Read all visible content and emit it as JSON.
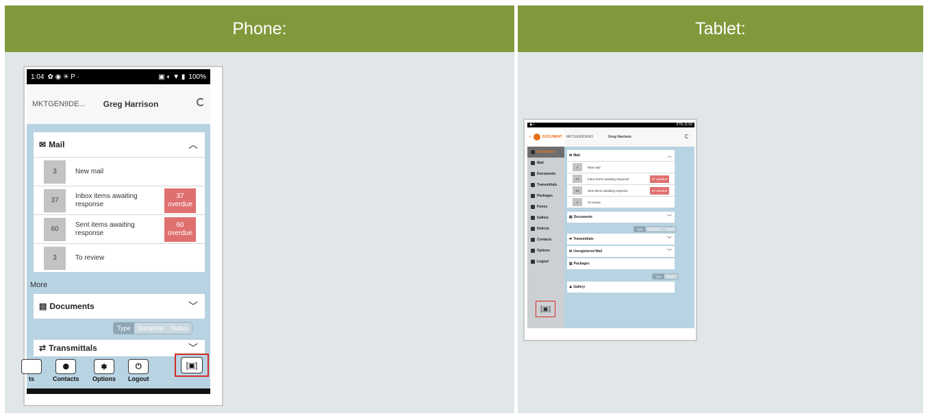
{
  "headers": {
    "phone": "Phone:",
    "tablet": "Tablet:"
  },
  "phone": {
    "status": {
      "time": "1:04",
      "right": "100%"
    },
    "account": "MKTGEN9DE...",
    "user": "Greg Harrison",
    "mail": {
      "title": "Mail",
      "rows": [
        {
          "count": "3",
          "label": "New mail",
          "overdue": ""
        },
        {
          "count": "37",
          "label": "Inbox items awaiting response",
          "overdue_num": "37",
          "overdue_text": "overdue"
        },
        {
          "count": "60",
          "label": "Sent items awaiting response",
          "overdue_num": "60",
          "overdue_text": "overdue"
        },
        {
          "count": "3",
          "label": "To review",
          "overdue": ""
        }
      ]
    },
    "more": "More",
    "documents": "Documents",
    "segments": [
      "Type",
      "Discipline",
      "Status"
    ],
    "transmittals": "Transmittals",
    "tabbar": [
      "ts",
      "Contacts",
      "Options",
      "Logout"
    ]
  },
  "tablet": {
    "status_right": "97% 11:00",
    "logo": "DOCUMENT",
    "account": "MKTGEN9DEMO",
    "user": "Greg Harrison",
    "sidebar": [
      "Dashboard",
      "Mail",
      "Documents",
      "Transmittals",
      "Packages",
      "Forms",
      "Gallery",
      "Defects",
      "Contacts",
      "Options",
      "Logout"
    ],
    "mail": {
      "title": "Mail",
      "rows": [
        {
          "count": "3",
          "label": "New mail",
          "overdue": ""
        },
        {
          "count": "37",
          "label": "Inbox items awaiting response",
          "overdue": "37 overdue"
        },
        {
          "count": "60",
          "label": "Sent items awaiting response",
          "overdue": "60 overdue"
        },
        {
          "count": "3",
          "label": "To review",
          "overdue": ""
        }
      ]
    },
    "documents": "Documents",
    "doc_segments": [
      "Type",
      "Discipline",
      "Status"
    ],
    "transmittals": "Transmittals",
    "unregistered": "Unregistered Mail",
    "packages": "Packages",
    "pkg_segments": [
      "Type",
      "Phase"
    ],
    "gallery": "Gallery"
  }
}
